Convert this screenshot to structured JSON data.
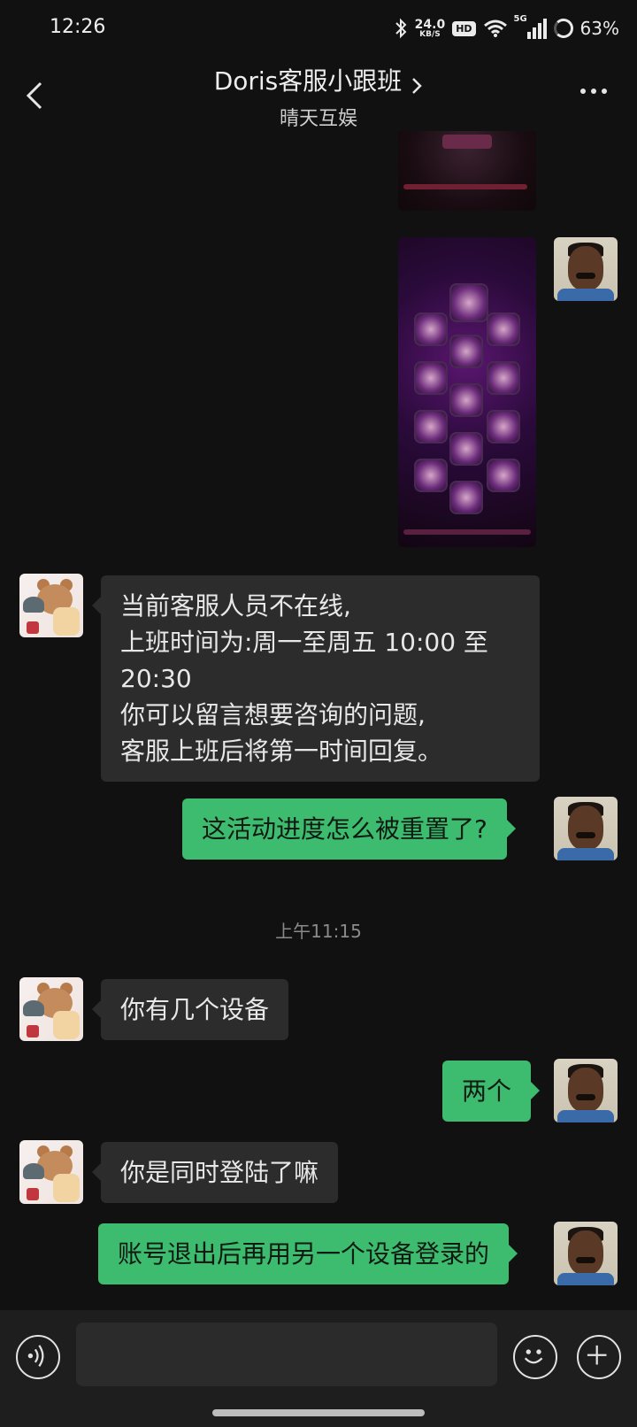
{
  "status_bar": {
    "time": "12:26",
    "net_speed_value": "24.0",
    "net_speed_unit": "KB/S",
    "hd_label": "HD",
    "network_label": "5G",
    "battery_percent": "63%"
  },
  "header": {
    "title": "Doris客服小跟班",
    "subtitle": "晴天互娱"
  },
  "messages": {
    "bot_offline": "当前客服人员不在线,\n上班时间为:周一至周五 10:00 至\n20:30\n你可以留言想要咨询的问题,\n客服上班后将第一时间回复。",
    "user_progress_reset": "这活动进度怎么被重置了?",
    "timestamp": "上午11:15",
    "bot_how_many_devices": "你有几个设备",
    "user_two": "两个",
    "bot_same_time": "你是同时登陆了嘛",
    "user_logout_login": "账号退出后再用另一个设备登录的"
  },
  "input_bar": {
    "placeholder": ""
  },
  "colors": {
    "background": "#111111",
    "incoming_bubble": "#2c2c2c",
    "outgoing_bubble": "#3dbb6e",
    "input_bar": "#1e1e1e"
  },
  "icons": [
    "back-icon",
    "chevron-right-icon",
    "more-icon",
    "voice-icon",
    "emoji-icon",
    "plus-icon",
    "bluetooth-icon",
    "wifi-icon",
    "signal-icon",
    "battery-icon"
  ]
}
